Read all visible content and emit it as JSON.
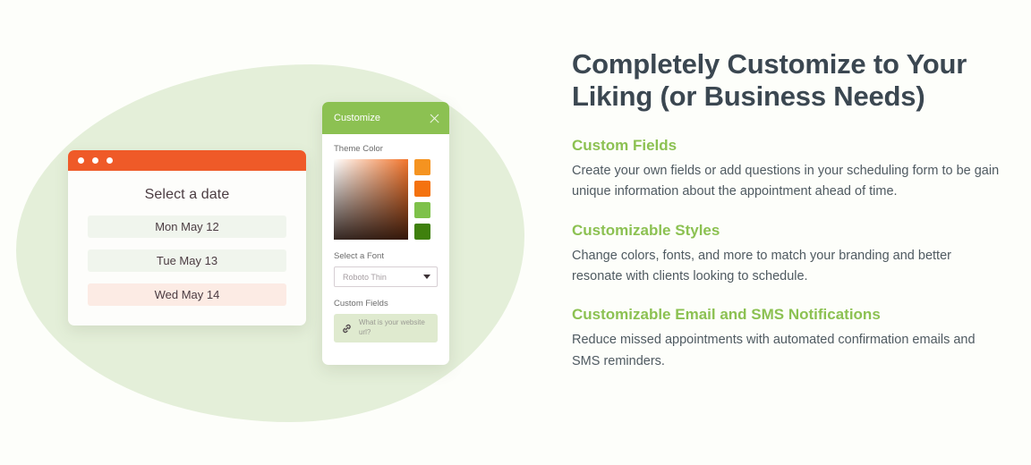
{
  "colors": {
    "page_background": "#fdfefa",
    "blob_green": "#e4efd9",
    "brand_green": "#8cc152",
    "orange_titlebar": "#ef5a28",
    "headline_slate": "#3b4751",
    "body_text": "#4f5a61"
  },
  "illustration": {
    "booking_window": {
      "title": "Select a date",
      "dates": [
        {
          "label": "Mon May 12",
          "state": "available"
        },
        {
          "label": "Tue May 13",
          "state": "available"
        },
        {
          "label": "Wed May 14",
          "state": "selected"
        }
      ]
    },
    "customize_panel": {
      "header_title": "Customize",
      "close_icon": "close-icon",
      "theme_color_label": "Theme Color",
      "gradient_hue": "#f2752c",
      "swatches": [
        {
          "name": "amber",
          "hex": "#f59320"
        },
        {
          "name": "orange",
          "hex": "#f4720f"
        },
        {
          "name": "light-green",
          "hex": "#7ec14a"
        },
        {
          "name": "dark-green",
          "hex": "#3f800d"
        }
      ],
      "font_label": "Select a Font",
      "font_value": "Roboto Thin",
      "font_caret_icon": "chevron-down-icon",
      "custom_fields_label": "Custom Fields",
      "custom_field": {
        "icon": "link-icon",
        "placeholder": "What is your website url?"
      }
    }
  },
  "content": {
    "headline": "Completely Customize to Your Liking (or Business Needs)",
    "features": [
      {
        "title": "Custom Fields",
        "description": "Create your own fields or add questions in your scheduling form to be gain unique information about the appointment ahead of time."
      },
      {
        "title": "Customizable Styles",
        "description": "Change colors, fonts, and more to match your branding and better resonate with clients looking to schedule."
      },
      {
        "title": "Customizable Email and SMS Notifications",
        "description": "Reduce missed appointments with automated confirmation emails and SMS reminders."
      }
    ]
  }
}
